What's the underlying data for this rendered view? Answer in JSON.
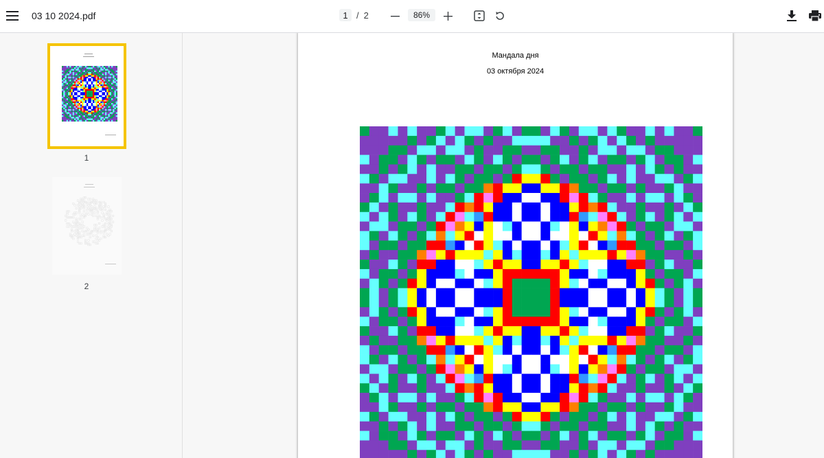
{
  "toolbar": {
    "menu_icon": "hamburger-menu-icon",
    "title": "03 10 2024.pdf",
    "page_current": "1",
    "page_separator": "/",
    "page_total": "2",
    "zoom_value": "86%",
    "minus_icon": "minus-icon",
    "plus_icon": "plus-icon",
    "fit_icon": "fit-page-icon",
    "rotate_icon": "rotate-icon",
    "download_icon": "download-icon",
    "print_icon": "print-icon"
  },
  "sidebar": {
    "thumbnails": [
      {
        "label": "1",
        "selected": true
      },
      {
        "label": "2",
        "selected": false
      }
    ],
    "selected_color": "#f5c400"
  },
  "page": {
    "heading": "Мандала дня",
    "date": "03 октября 2024"
  },
  "mandala": {
    "palette": [
      "#ffffff",
      "#0000ff",
      "#ff0000",
      "#ffff00",
      "#00a651",
      "#66ffff",
      "#7f3fbf",
      "#ff80ff",
      "#ff7f00",
      "#3399ff"
    ]
  }
}
